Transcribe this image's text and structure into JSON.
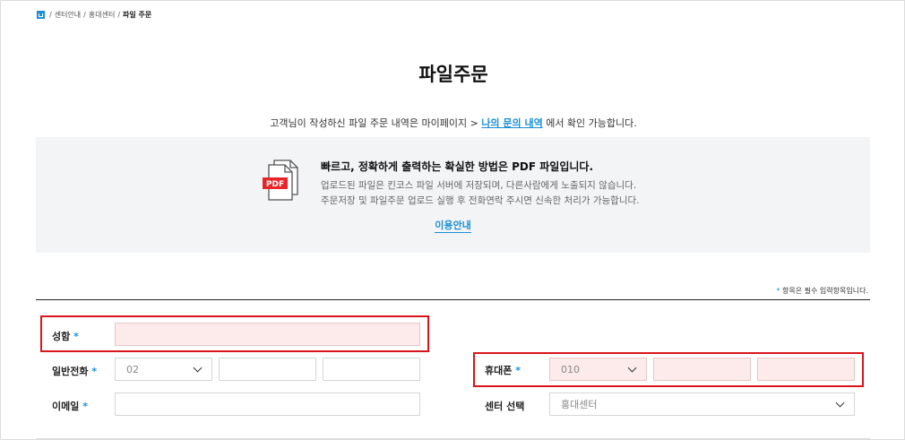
{
  "breadcrumb": {
    "items": [
      "센터안내",
      "홍대센터",
      "파일 주문"
    ]
  },
  "page": {
    "title": "파일주문"
  },
  "intro": {
    "before": "고객님이 작성하신 파일 주문 내역은 마이페이지 > ",
    "link": "나의 문의 내역",
    "after": " 에서 확인 가능합니다."
  },
  "info": {
    "pdf_label": "PDF",
    "headline": "빠르고, 정확하게 출력하는 확실한 방법은 PDF 파일입니다.",
    "line1": "업로드된 파일은 킨코스 파일 서버에 저장되며, 다른사람에게 노출되지 않습니다.",
    "line2": "주문저장 및 파일주문 업로드 실행 후 전화연락 주시면 신속한 처리가 가능합니다.",
    "guide_link": "이용안내"
  },
  "required_note": {
    "star": "*",
    "text": " 항목은 필수 입력항목입니다."
  },
  "form": {
    "star": "*",
    "name_label": "성함",
    "phone_label": "일반전화",
    "phone_prefix": "02",
    "email_label": "이메일",
    "mobile_label": "휴대폰",
    "mobile_prefix": "010",
    "center_label": "센터 선택",
    "center_value": "홍대센터"
  },
  "colors": {
    "accent": "#1a8fd6",
    "highlight": "#d9151b",
    "pdf_badge": "#e8262a"
  }
}
